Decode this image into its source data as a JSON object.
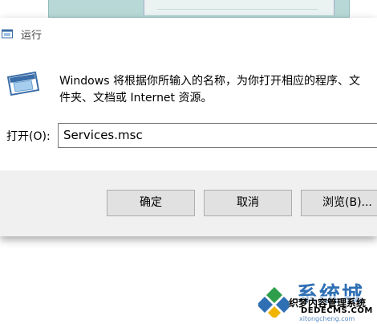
{
  "dialog": {
    "title": "运行",
    "description_line1": "Windows 将根据你所输入的名称，为你打开相应的程序、文",
    "description_line2": "件夹、文档或 Internet 资源。",
    "open_label": "打开(O):",
    "open_value": "Services.msc"
  },
  "buttons": {
    "ok": "确定",
    "cancel": "取消",
    "browse": "浏览(B)..."
  },
  "watermark": {
    "brand": "系统城",
    "line1": "织梦内容管理系统",
    "line2": "DEDECMS.COM",
    "line3": "xitongcheng.com"
  }
}
